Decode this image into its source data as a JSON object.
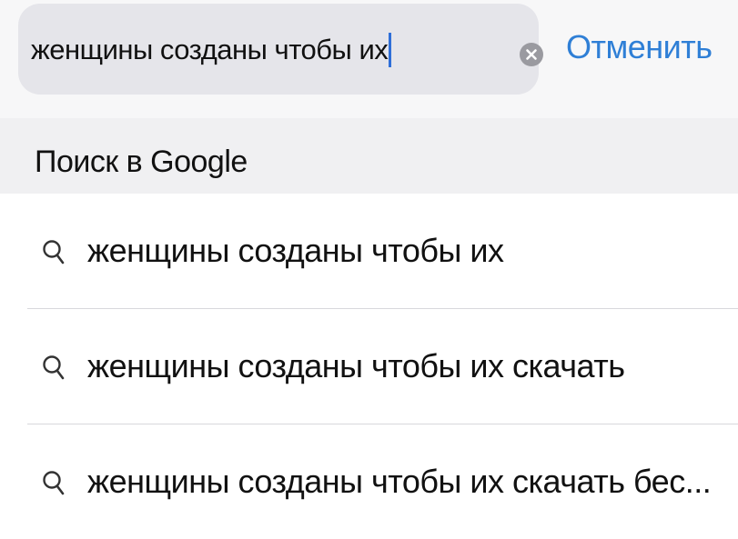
{
  "search": {
    "query": "женщины созданы чтобы их",
    "cancel_label": "Отменить"
  },
  "section": {
    "title": "Поиск в Google"
  },
  "suggestions": [
    {
      "text": "женщины созданы чтобы их",
      "icon": "search-icon"
    },
    {
      "text": "женщины созданы чтобы их скачать",
      "icon": "search-icon"
    },
    {
      "text": "женщины созданы чтобы их скачать бес...",
      "icon": "search-icon"
    }
  ],
  "colors": {
    "accent": "#2f7fd6",
    "caret": "#2f6fd8",
    "field_background": "#e5e5ea",
    "section_background": "#f0f0f2"
  }
}
